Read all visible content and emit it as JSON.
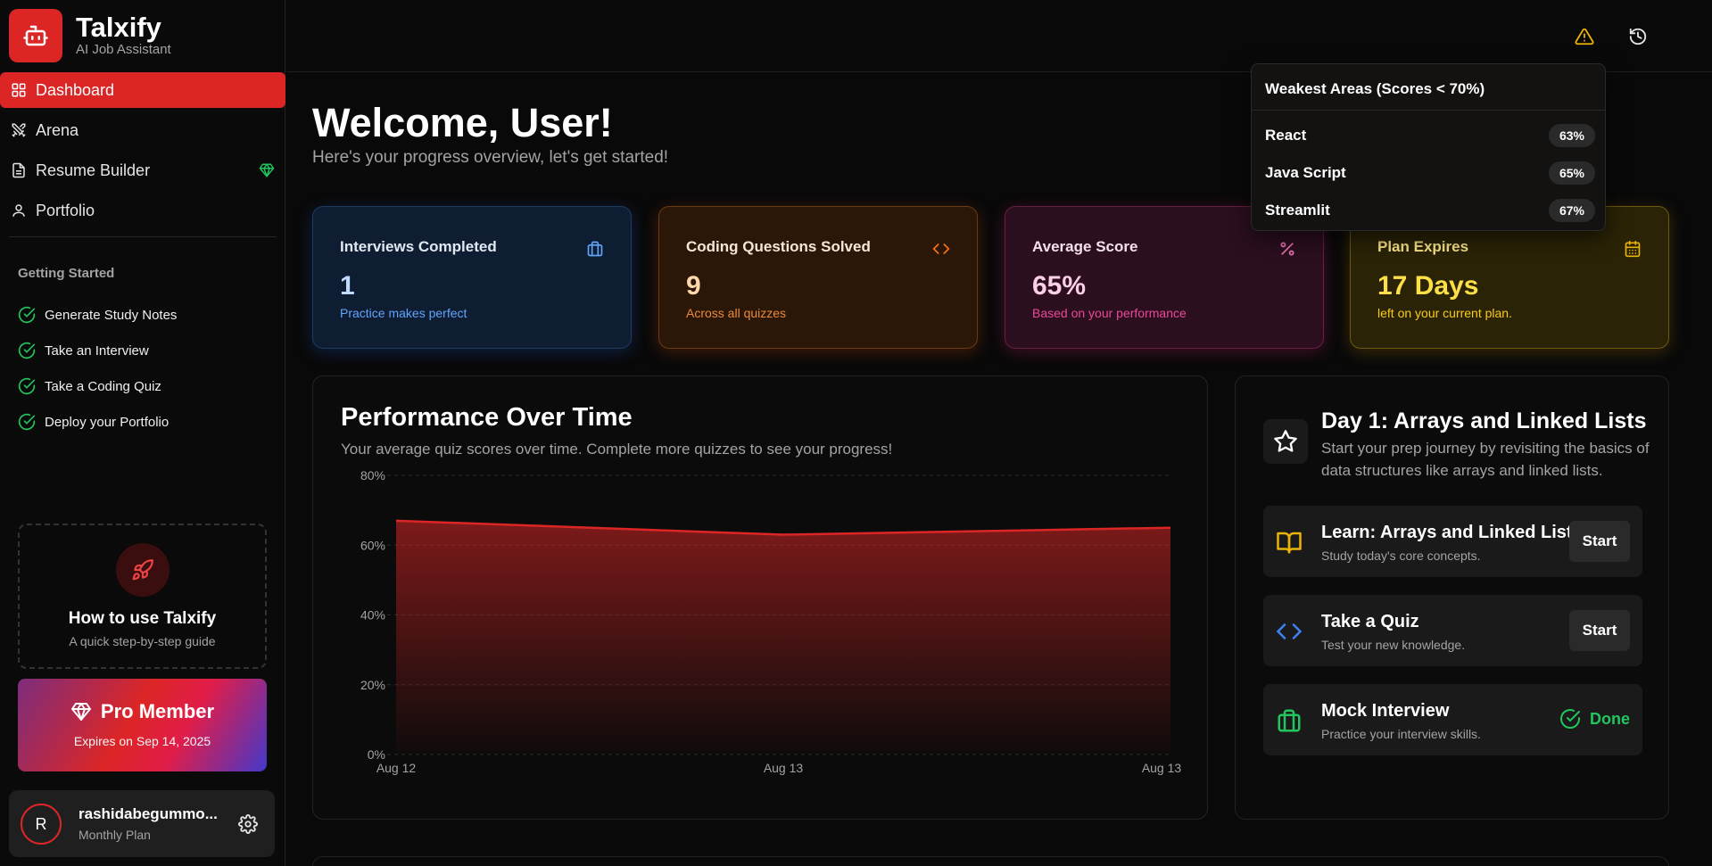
{
  "brand": {
    "name": "Talxify",
    "tagline": "AI Job Assistant"
  },
  "nav": {
    "items": [
      {
        "label": "Dashboard",
        "icon": "grid-icon",
        "active": true
      },
      {
        "label": "Arena",
        "icon": "swords-icon"
      },
      {
        "label": "Resume Builder",
        "icon": "document-icon",
        "badge": "gem-icon"
      },
      {
        "label": "Portfolio",
        "icon": "user-icon"
      }
    ]
  },
  "getting_started": {
    "title": "Getting Started",
    "items": [
      "Generate Study Notes",
      "Take an Interview",
      "Take a Coding Quiz",
      "Deploy your Portfolio"
    ]
  },
  "help": {
    "title": "How to use Talxify",
    "subtitle": "A quick step-by-step guide"
  },
  "pro": {
    "title": "Pro Member",
    "expires": "Expires on Sep 14, 2025"
  },
  "user": {
    "initial": "R",
    "name": "rashidabegummo...",
    "plan": "Monthly Plan"
  },
  "header": {
    "icons": [
      "warning-icon",
      "history-icon"
    ]
  },
  "welcome": {
    "title": "Welcome, User!",
    "subtitle": "Here's your progress overview, let's get started!"
  },
  "stats": [
    {
      "title": "Interviews Completed",
      "value": "1",
      "sub": "Practice makes perfect",
      "icon": "briefcase-icon",
      "color": "#2563eb"
    },
    {
      "title": "Coding Questions Solved",
      "value": "9",
      "sub": "Across all quizzes",
      "icon": "code-icon",
      "color": "#ea580c"
    },
    {
      "title": "Average Score",
      "value": "65%",
      "sub": "Based on your performance",
      "icon": "percent-icon",
      "color": "#db2777"
    },
    {
      "title": "Plan Expires",
      "value": "17 Days",
      "sub": "left on your current plan.",
      "icon": "calendar-icon",
      "color": "#ca8a04"
    }
  ],
  "performance": {
    "title": "Performance Over Time",
    "subtitle": "Your average quiz scores over time. Complete more quizzes to see your progress!"
  },
  "chart_data": {
    "type": "area",
    "x": [
      "Aug 12",
      "Aug 13",
      "Aug 13"
    ],
    "y_ticks": [
      "0%",
      "20%",
      "40%",
      "60%",
      "80%"
    ],
    "ylim": [
      0,
      80
    ],
    "series": [
      {
        "values": [
          67,
          63,
          65
        ]
      }
    ],
    "grid": true,
    "color": "#dc2626"
  },
  "plan": {
    "title": "Day 1: Arrays and Linked Lists",
    "description": "Start your prep journey by revisiting the basics of data structures like arrays and linked lists.",
    "tasks": [
      {
        "title": "Learn: Arrays and Linked Lists",
        "sub": "Study today's core concepts.",
        "action": "Start",
        "icon": "book-icon"
      },
      {
        "title": "Take a Quiz",
        "sub": "Test your new knowledge.",
        "action": "Start",
        "icon": "code-icon"
      },
      {
        "title": "Mock Interview",
        "sub": "Practice your interview skills.",
        "action": "Done",
        "icon": "briefcase-icon"
      }
    ]
  },
  "weakest": {
    "title": "Weakest Areas (Scores < 70%)",
    "items": [
      {
        "name": "React",
        "score": "63%"
      },
      {
        "name": "Java Script",
        "score": "65%"
      },
      {
        "name": "Streamlit",
        "score": "67%"
      }
    ]
  }
}
